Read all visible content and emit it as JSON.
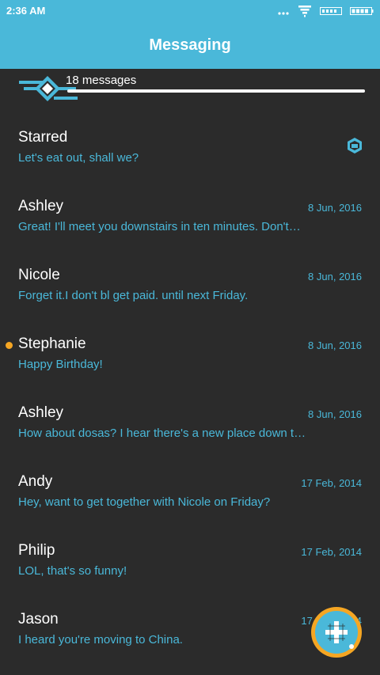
{
  "status_bar": {
    "time": "2:36 AM",
    "icons": [
      "more-dots-icon",
      "signal-funnel-icon",
      "signal-bars-icon",
      "battery-icon"
    ]
  },
  "header": {
    "title": "Messaging"
  },
  "message_count": {
    "label": "18 messages"
  },
  "conversations": [
    {
      "name": "Starred",
      "preview": "Let's eat out, shall we?",
      "date": "",
      "unread": false,
      "starred": true
    },
    {
      "name": "Ashley",
      "preview": "Great! I'll meet you downstairs in ten minutes. Don't…",
      "date": "8 Jun, 2016",
      "unread": false,
      "starred": false
    },
    {
      "name": "Nicole",
      "preview": "Forget it.I don't bl get paid. until next Friday.",
      "date": "8 Jun, 2016",
      "unread": false,
      "starred": false
    },
    {
      "name": "Stephanie",
      "preview": "Happy Birthday!",
      "date": "8 Jun, 2016",
      "unread": true,
      "starred": false
    },
    {
      "name": "Ashley",
      "preview": "How about dosas? I hear there's a new place down t…",
      "date": "8 Jun, 2016",
      "unread": false,
      "starred": false
    },
    {
      "name": "Andy",
      "preview": "Hey, want to get together with Nicole on Friday?",
      "date": "17 Feb, 2014",
      "unread": false,
      "starred": false
    },
    {
      "name": "Philip",
      "preview": "LOL, that's so funny!",
      "date": "17 Feb, 2014",
      "unread": false,
      "starred": false
    },
    {
      "name": "Jason",
      "preview": "I heard you're moving to China.",
      "date": "17 Feb, 2014",
      "unread": false,
      "starred": false
    }
  ],
  "fab": {
    "icon": "compose-plus-icon"
  },
  "colors": {
    "accent": "#4ab8d9",
    "background": "#2b2b2b",
    "unread_dot": "#f5a623",
    "fab_ring": "#f5a623"
  }
}
